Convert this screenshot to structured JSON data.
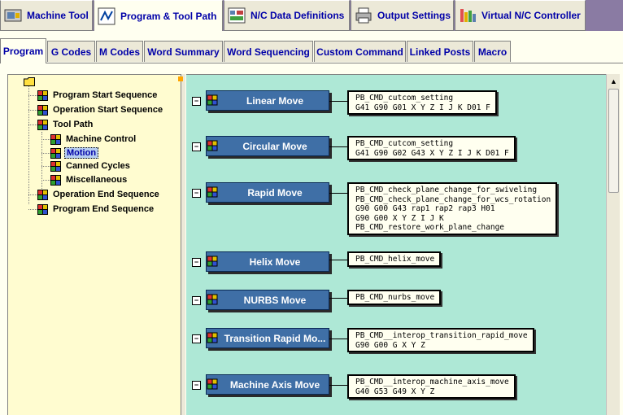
{
  "top_tabs": [
    {
      "label": "Machine Tool",
      "icon": "machine-tool-icon"
    },
    {
      "label": "Program & Tool Path",
      "icon": "program-toolpath-icon"
    },
    {
      "label": "N/C Data Definitions",
      "icon": "nc-data-icon"
    },
    {
      "label": "Output Settings",
      "icon": "printer-icon"
    },
    {
      "label": "Virtual N/C Controller",
      "icon": "virtual-controller-icon"
    }
  ],
  "sub_tabs": [
    "Program",
    "G Codes",
    "M Codes",
    "Word Summary",
    "Word Sequencing",
    "Custom Command",
    "Linked Posts",
    "Macro"
  ],
  "tree": {
    "items": [
      "Program Start Sequence",
      "Operation Start Sequence",
      "Tool Path",
      "Machine Control",
      "Motion",
      "Canned Cycles",
      "Miscellaneous",
      "Operation End Sequence",
      "Program End Sequence"
    ],
    "selected": "Motion"
  },
  "motions": [
    {
      "label": "Linear Move",
      "commands": "PB_CMD_cutcom_setting\nG41 G90 G01 X Y Z I J K D01 F"
    },
    {
      "label": "Circular Move",
      "commands": "PB_CMD_cutcom_setting\nG41 G90 G02 G43 X Y Z I J K D01 F"
    },
    {
      "label": "Rapid Move",
      "commands": "PB_CMD_check_plane_change_for_swiveling\nPB_CMD_check_plane_change_for_wcs_rotation\nG90 G00 G43 rap1 rap2 rap3 H01\nG90 G00 X Y Z I J K\nPB_CMD_restore_work_plane_change"
    },
    {
      "label": "Helix Move",
      "commands": "PB_CMD_helix_move"
    },
    {
      "label": "NURBS Move",
      "commands": "PB_CMD_nurbs_move"
    },
    {
      "label": "Transition Rapid Mo...",
      "commands": "PB_CMD__interop_transition_rapid_move\nG90 G00 G X Y Z"
    },
    {
      "label": "Machine Axis Move",
      "commands": "PB_CMD__interop_machine_axis_move\nG40 G53 G49 X Y Z"
    }
  ],
  "collapse_symbol": "−"
}
